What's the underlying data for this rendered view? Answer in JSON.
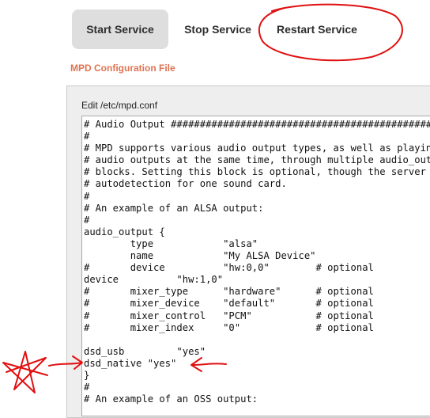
{
  "toolbar": {
    "start_label": "Start Service",
    "stop_label": "Stop Service",
    "restart_label": "Restart Service"
  },
  "section_title": "MPD Configuration File",
  "editor": {
    "label": "Edit /etc/mpd.conf",
    "lines": [
      "# Audio Output ####################################################",
      "#",
      "# MPD supports various audio output types, as well as playing",
      "# audio outputs at the same time, through multiple audio_output",
      "# blocks. Setting this block is optional, though the server",
      "# autodetection for one sound card.",
      "#",
      "# An example of an ALSA output:",
      "#",
      "audio_output {",
      "        type            \"alsa\"",
      "        name            \"My ALSA Device\"",
      "#       device          \"hw:0,0\"        # optional",
      "device          \"hw:1,0\"",
      "#       mixer_type      \"hardware\"      # optional",
      "#       mixer_device    \"default\"       # optional",
      "#       mixer_control   \"PCM\"           # optional",
      "#       mixer_index     \"0\"             # optional",
      "",
      "dsd_usb         \"yes\"",
      "dsd_native \"yes\"",
      "}",
      "#",
      "# An example of an OSS output:"
    ]
  },
  "annotation_colors": {
    "markup": "#e01010",
    "accent": "#e07352"
  }
}
